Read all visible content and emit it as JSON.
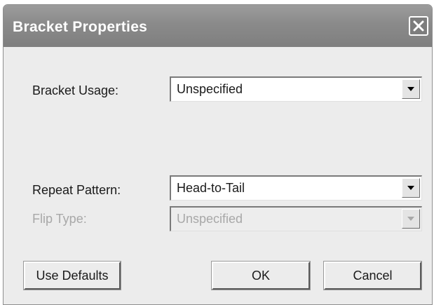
{
  "window": {
    "title": "Bracket Properties",
    "close_icon": "close-icon"
  },
  "fields": {
    "bracket_usage": {
      "label": "Bracket Usage:",
      "value": "Unspecified",
      "enabled": true
    },
    "repeat_pattern": {
      "label": "Repeat Pattern:",
      "value": "Head-to-Tail",
      "enabled": true
    },
    "flip_type": {
      "label": "Flip Type:",
      "value": "Unspecified",
      "enabled": false
    }
  },
  "buttons": {
    "use_defaults": "Use Defaults",
    "ok": "OK",
    "cancel": "Cancel"
  },
  "colors": {
    "titlebar": "#8a8a8a",
    "dialog_bg": "#ececec",
    "disabled_text": "#a8a8a8"
  }
}
